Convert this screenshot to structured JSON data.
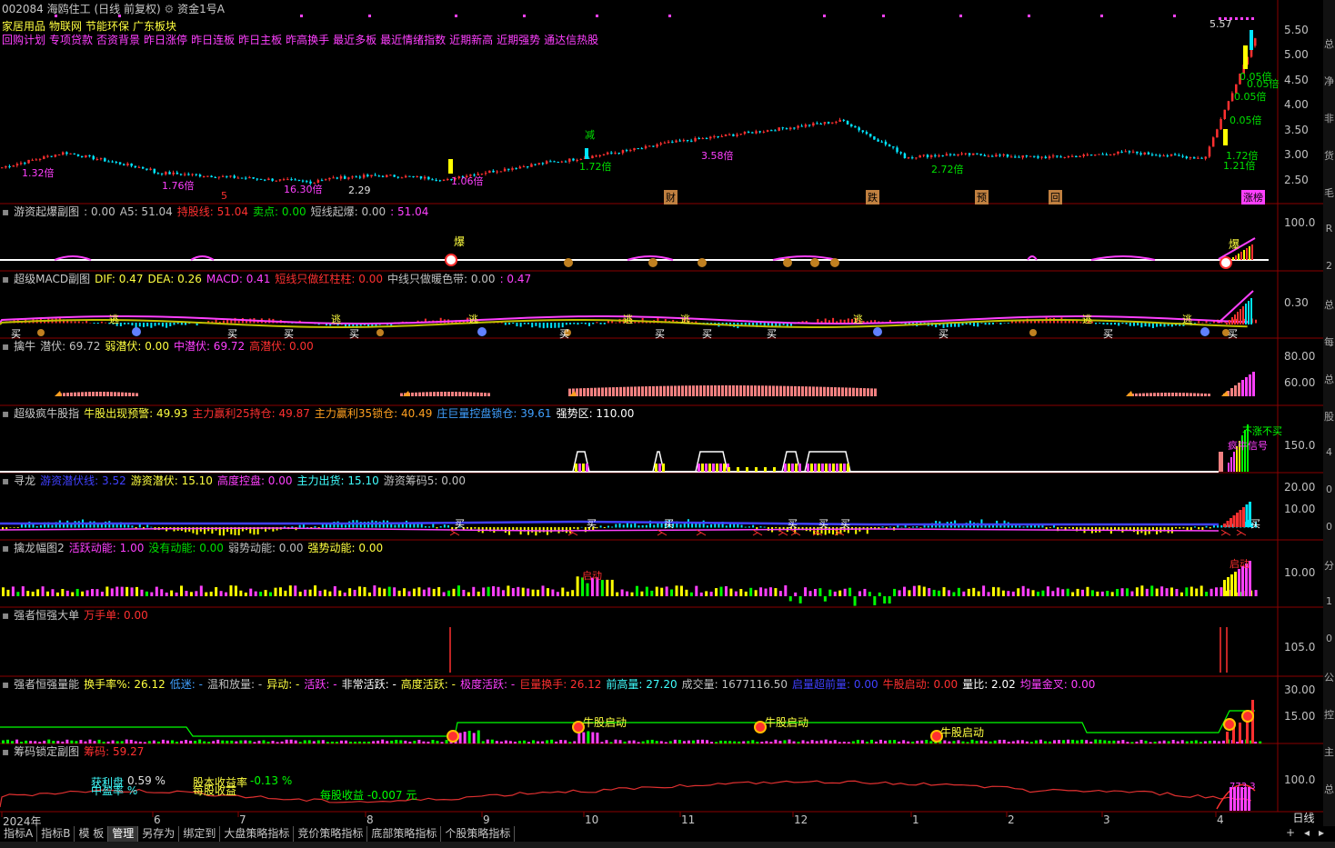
{
  "window": {
    "stock_code": "002084",
    "stock_name": "海鸥住工",
    "period": "(日线 前复权)",
    "account": "资金1号A",
    "period_button": "日线"
  },
  "main_chart": {
    "labels_row1": [
      "家居用品",
      "物联网",
      "节能环保",
      "广东板块"
    ],
    "labels_row2": [
      "回购计划",
      "专项贷款",
      "否资背景",
      "昨日涨停",
      "昨日连板",
      "昨日主板",
      "昨高换手",
      "最近多板",
      "最近情绪指数",
      "近期新高",
      "近期强势",
      "通达信热股"
    ],
    "annotations": [
      "5.57",
      "0.05倍",
      "0.05倍",
      "0.05倍",
      "0.05倍",
      "1.72倍",
      "1.21倍",
      "1.72倍",
      "3.58倍",
      "2.72倍",
      "1.32倍",
      "1.76倍",
      "16.30倍",
      "1.06倍",
      "2.29",
      "减",
      "5",
      "财",
      "跌",
      "预",
      "回",
      "涨榜"
    ],
    "y_ticks": [
      "5.50",
      "5.00",
      "4.50",
      "4.00",
      "3.50",
      "3.00",
      "2.50"
    ]
  },
  "panes": [
    {
      "id": "youzi",
      "title": "游资起爆副图",
      "items": [
        {
          "t": ": 0.00",
          "c": "#c0c0c0"
        },
        {
          "t": "A5: 51.04",
          "c": "#c0c0c0"
        },
        {
          "t": "持股线: 51.04",
          "c": "#ff3030"
        },
        {
          "t": "卖点: 0.00",
          "c": "#00e000"
        },
        {
          "t": "短线起爆: 0.00",
          "c": "#c0c0c0"
        },
        {
          "t": ": 51.04",
          "c": "#ff40ff"
        }
      ],
      "ticks": [
        "100.0"
      ]
    },
    {
      "id": "macd",
      "title": "超级MACD副图",
      "items": [
        {
          "t": "DIF: 0.47",
          "c": "#ffff40"
        },
        {
          "t": "DEA: 0.26",
          "c": "#ffff40"
        },
        {
          "t": "MACD: 0.41",
          "c": "#ff40ff"
        },
        {
          "t": "短线只做红柱柱: 0.00",
          "c": "#ff3030"
        },
        {
          "t": "中线只做暖色带: 0.00",
          "c": "#c0c0c0"
        },
        {
          "t": ": 0.47",
          "c": "#ff40ff"
        }
      ],
      "ticks": [
        "0.30"
      ]
    },
    {
      "id": "qinniu",
      "title": "擒牛",
      "items": [
        {
          "t": "潜伏: 69.72",
          "c": "#c0c0c0"
        },
        {
          "t": "弱潜伏: 0.00",
          "c": "#ffff40"
        },
        {
          "t": "中潜伏: 69.72",
          "c": "#ff40ff"
        },
        {
          "t": "高潜伏: 0.00",
          "c": "#ff3030"
        }
      ],
      "ticks": [
        "80.00",
        "60.00"
      ]
    },
    {
      "id": "fengniu",
      "title": "超级疯牛股指",
      "items": [
        {
          "t": "牛股出现预警: 49.93",
          "c": "#ffff40"
        },
        {
          "t": "主力赢利25持仓: 49.87",
          "c": "#ff3030"
        },
        {
          "t": "主力赢利35锁仓: 40.49",
          "c": "#ffa020"
        },
        {
          "t": "庄巨量控盘锁仓: 39.61",
          "c": "#40a0ff"
        },
        {
          "t": "强势区: 110.00",
          "c": "#ffffff"
        }
      ],
      "ticks": [
        "150.0"
      ]
    },
    {
      "id": "xunlong",
      "title": "寻龙",
      "items": [
        {
          "t": "游资潜伏线: 3.52",
          "c": "#4040ff"
        },
        {
          "t": "游资潜伏: 15.10",
          "c": "#ffff40"
        },
        {
          "t": "高度控盘: 0.00",
          "c": "#ff40ff"
        },
        {
          "t": "主力出货: 15.10",
          "c": "#40ffff"
        },
        {
          "t": "游资筹码5: 0.00",
          "c": "#c0c0c0"
        }
      ],
      "ticks": [
        "20.00",
        "10.00"
      ]
    },
    {
      "id": "qinlong",
      "title": "擒龙幅图2",
      "items": [
        {
          "t": "活跃动能: 1.00",
          "c": "#ff40ff"
        },
        {
          "t": "没有动能: 0.00",
          "c": "#00e000"
        },
        {
          "t": "弱势动能: 0.00",
          "c": "#c0c0c0"
        },
        {
          "t": "强势动能: 0.00",
          "c": "#ffff40"
        }
      ],
      "ticks": [
        "10.00"
      ]
    },
    {
      "id": "qiangzhe",
      "title": "强者恒强大单",
      "items": [
        {
          "t": "万手单: 0.00",
          "c": "#ff3030"
        }
      ],
      "ticks": [
        "105.0"
      ]
    },
    {
      "id": "liangneng",
      "title": "强者恒强量能",
      "items": [
        {
          "t": "换手率%: 26.12",
          "c": "#ffff40"
        },
        {
          "t": "低迷: -",
          "c": "#40a0ff"
        },
        {
          "t": "温和放量: -",
          "c": "#c0c0c0"
        },
        {
          "t": "异动: -",
          "c": "#ffff40"
        },
        {
          "t": "活跃: -",
          "c": "#ff40ff"
        },
        {
          "t": "非常活跃: -",
          "c": "#ffffff"
        },
        {
          "t": "高度活跃: -",
          "c": "#ffff40"
        },
        {
          "t": "极度活跃: -",
          "c": "#ff40ff"
        },
        {
          "t": "巨量换手: 26.12",
          "c": "#ff3030"
        },
        {
          "t": "前高量: 27.20",
          "c": "#40ffff"
        },
        {
          "t": "成交量: 1677116.50",
          "c": "#c0c0c0"
        },
        {
          "t": "启量超前量: 0.00",
          "c": "#4040ff"
        },
        {
          "t": "牛股启动: 0.00",
          "c": "#ff3030"
        },
        {
          "t": "量比: 2.02",
          "c": "#ffffff"
        },
        {
          "t": "均量金叉: 0.00",
          "c": "#ff40ff"
        }
      ],
      "ticks": [
        "30.00",
        "15.00"
      ]
    },
    {
      "id": "chouma",
      "title": "筹码锁定副图",
      "items": [
        {
          "t": "筹码: 59.27",
          "c": "#ff3030"
        }
      ],
      "ticks": [
        "100.0"
      ]
    }
  ],
  "chouma_texts": {
    "profit_rate": "0.59 %",
    "profit_label_a": "获利盘",
    "profit_label_b": "总盈率",
    "profit_label_c": "中盈率 %",
    "cost_income": "股本收益率",
    "cost_income_val": "-0.13 %",
    "eps_label": "每股收益",
    "eps_text": "每股收益 -0.007 元",
    "peak": "773.3"
  },
  "signal_texts": {
    "bao": "爆",
    "tao": "逃",
    "mai": "买",
    "niugu": "牛股启动",
    "qidong": "启动",
    "buzhang": "不涨不买",
    "niugu_flag": "疯牛信号"
  },
  "dates": [
    "2024年",
    "6",
    "7",
    "8",
    "9",
    "10",
    "11",
    "12",
    "1",
    "2",
    "3",
    "4"
  ],
  "bottom_tabs": [
    "指标A",
    "指标B",
    "模 板",
    "管理",
    "另存为",
    "绑定到",
    "大盘策略指标",
    "竞价策略指标",
    "底部策略指标",
    "个股策略指标"
  ],
  "right_strip": [
    "总",
    "净",
    "非",
    "货",
    "毛",
    "R",
    "2",
    "总",
    "每",
    "总",
    "股",
    "4",
    "0",
    "0",
    "分",
    "1",
    "0",
    "公",
    "控",
    "主",
    "总"
  ],
  "colors": {
    "up": "#ff3030",
    "down": "#00e5ff",
    "axis": "#8a0000",
    "ma": "#ffffff"
  }
}
